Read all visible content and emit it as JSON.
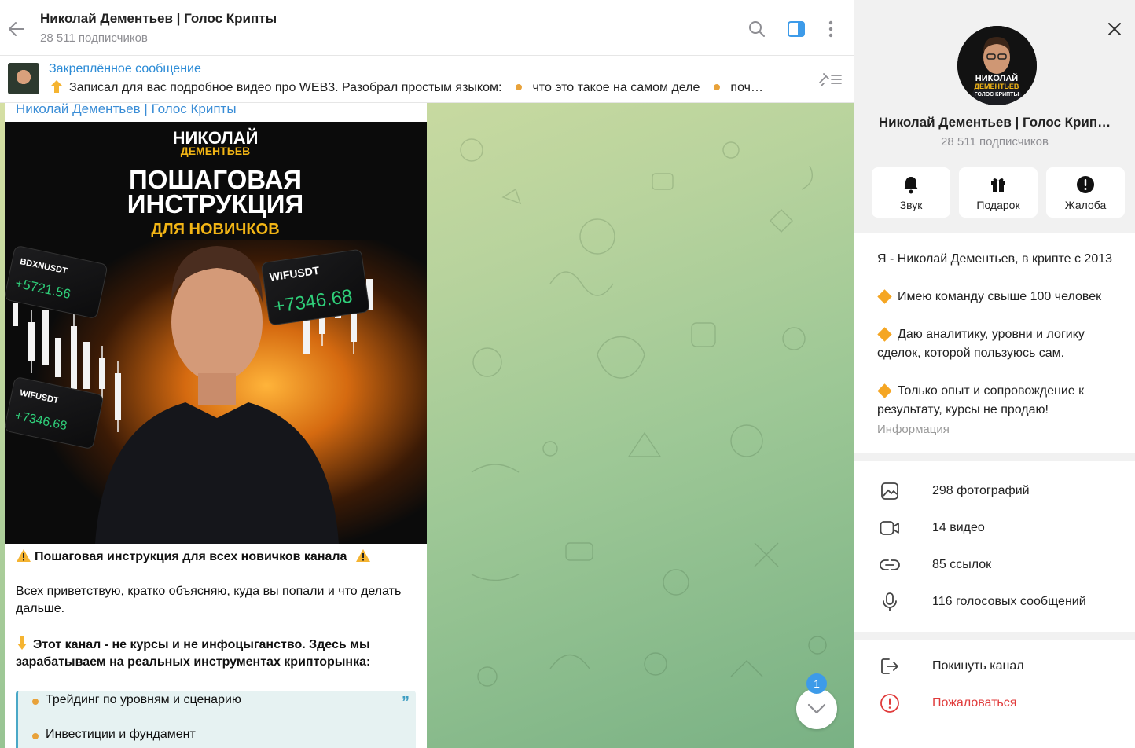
{
  "header": {
    "title": "Николай Дементьев | Голос Крипты",
    "subscribers": "28 511 подписчиков"
  },
  "pinned": {
    "label": "Закреплённое сообщение",
    "text_start": "Записал для вас подробное видео про WEB3.  Разобрал простым языком:",
    "text_item1": "что это такое на самом деле",
    "text_item2": "поч…"
  },
  "message": {
    "author": "Николай Дементьев | Голос Крипты",
    "photo": {
      "brand_top": "НИКОЛАЙ",
      "brand_bottom": "ДЕМЕНТЬЕВ",
      "title_1": "ПОШАГОВАЯ",
      "title_2": "ИНСТРУКЦИЯ",
      "title_3": "ДЛЯ НОВИЧКОВ",
      "card1_symbol": "BDXNUSDT",
      "card1_value": "+5721.56",
      "card2_symbol": "WIFUSDT",
      "card2_value": "+7346.68",
      "card3_symbol": "WIFUSDT",
      "card3_value": "+7346.68"
    },
    "heading": "Пошаговая инструкция для всех новичков канала",
    "para1": "Всех приветствую, кратко объясняю, куда вы попали и что делать дальше.",
    "para2": "Этот канал - не курсы и не инфоцыганство. Здесь мы зарабатываем на реальных инструментах крипторынка:",
    "quote_items": [
      "Трейдинг по уровням и сценарию",
      "Инвестиции и фундамент"
    ]
  },
  "scroll_badge": "1",
  "panel": {
    "name": "Николай Дементьев | Голос Крип…",
    "subscribers": "28 511 подписчиков",
    "avatar": {
      "line1": "НИКОЛАЙ",
      "line2": "ДЕМЕНТЬЕВ",
      "line3": "ГОЛОС КРИПТЫ"
    },
    "actions": [
      {
        "label": "Звук",
        "icon": "bell-icon"
      },
      {
        "label": "Подарок",
        "icon": "gift-icon"
      },
      {
        "label": "Жалоба",
        "icon": "alert-icon"
      }
    ],
    "about": {
      "line1": "Я - Николай Дементьев, в крипте с 2013",
      "line2": "Имею команду свыше 100 человек",
      "line3": "Даю аналитику, уровни и логику сделок, которой пользуюсь сам.",
      "line4": "Только опыт и сопровождение к результату, курсы не продаю!",
      "label": "Информация"
    },
    "media": [
      {
        "label": "298 фотографий",
        "icon": "photo-icon"
      },
      {
        "label": "14 видео",
        "icon": "video-icon"
      },
      {
        "label": "85 ссылок",
        "icon": "link-icon"
      },
      {
        "label": "116 голосовых сообщений",
        "icon": "microphone-icon"
      }
    ],
    "leave": "Покинуть канал",
    "report": "Пожаловаться"
  },
  "colors": {
    "accent": "#3a8dd6",
    "danger": "#e03b3b",
    "bullet": "#e8a23a",
    "chat_bg": "#b8d39d"
  }
}
